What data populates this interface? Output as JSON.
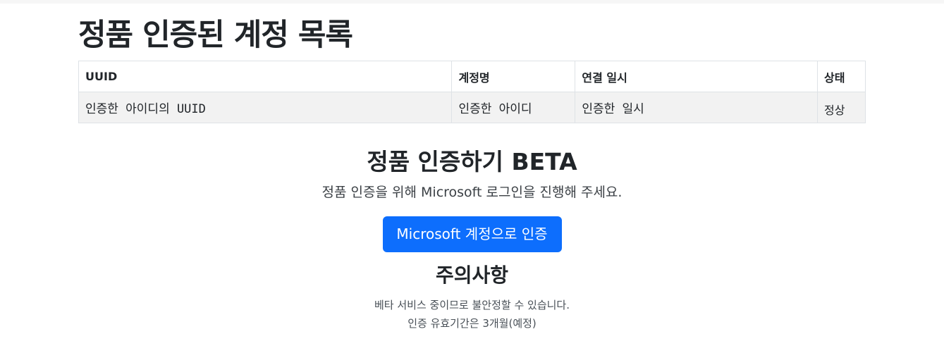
{
  "accounts_section": {
    "title": "정품 인증된 계정 목록",
    "table": {
      "headers": [
        "UUID",
        "계정명",
        "연결 일시",
        "상태"
      ],
      "rows": [
        [
          "인증한 아이디의 UUID",
          "인증한 아이디",
          "인증한 일시",
          "정상"
        ]
      ]
    }
  },
  "verify_section": {
    "title": "정품 인증하기 BETA",
    "description": "정품 인증을 위해 Microsoft 로그인을 진행해 주세요.",
    "button_label": "Microsoft 계정으로 인증"
  },
  "notice_section": {
    "title": "주의사항",
    "lines": [
      "베타 서비스 중이므로 불안정할 수 있습니다.",
      "인증 유효기간은 3개월(예정)"
    ]
  },
  "colors": {
    "primary_button": "#0d6efd",
    "table_row_bg": "#f2f2f2",
    "table_border": "#dee2e6"
  }
}
